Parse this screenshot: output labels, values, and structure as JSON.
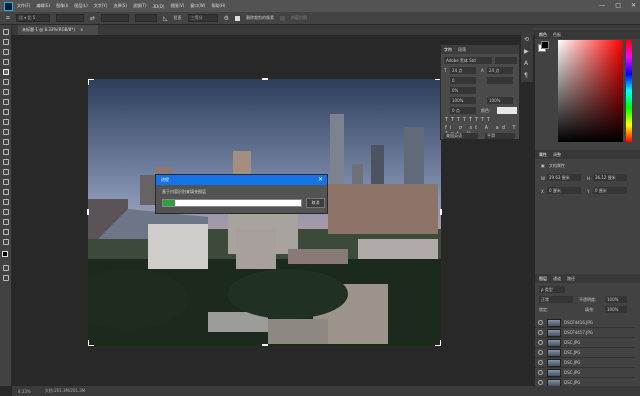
{
  "menubar": {
    "items": [
      "文件(F)",
      "编辑(E)",
      "图像(I)",
      "图层(L)",
      "文字(Y)",
      "选择(S)",
      "滤镜(T)",
      "3D(D)",
      "视图(V)",
      "窗口(W)",
      "帮助(H)"
    ],
    "window_controls": [
      "—",
      "□",
      "✕"
    ]
  },
  "options": {
    "ratio": "比 ▾ 比 5",
    "straighten_label": "拉直",
    "view_label": "三等分",
    "delete_pixels_label": "删除裁剪的像素",
    "content_aware_label": "内容识别"
  },
  "document": {
    "tab_label": "未标题-1 @ 8.33%(RGB/8*)",
    "tab_close": "×"
  },
  "dialog": {
    "title": "进程",
    "close": "✕",
    "message": "基于内容识别来填充图层",
    "progress_percent": 9,
    "cancel_label": "取消"
  },
  "character_panel": {
    "tabs": [
      "字符",
      "段落"
    ],
    "font_family": "Adobe 黑体 Std",
    "size": "24 点",
    "leading": "24 点",
    "tracking": "0",
    "kerning": "0%",
    "scale_v": "100%",
    "scale_h": "100%",
    "baseline": "0 点",
    "color_label": "颜色:",
    "lang": "美国英语",
    "aa": "平滑"
  },
  "color_panel": {
    "tabs": [
      "颜色",
      "色板"
    ]
  },
  "properties_panel": {
    "tabs": [
      "属性",
      "调整"
    ],
    "doc_label": "文档属性",
    "w_label": "W",
    "w_value": "29.63 厘米",
    "h_label": "H",
    "h_value": "36.12 厘米",
    "x_label": "X",
    "x_value": "0 厘米",
    "y_label": "Y",
    "y_value": "0 厘米"
  },
  "layers_panel": {
    "tabs": [
      "图层",
      "通道",
      "路径"
    ],
    "filter_label": "ρ 类型",
    "blend_mode": "正常",
    "opacity_label": "不透明度:",
    "opacity": "100%",
    "lock_label": "锁定:",
    "fill_label": "填充:",
    "fill": "100%",
    "layers": [
      "DSCF4416.JPG",
      "DSCF4417.JPG",
      "DSC.JPG",
      "DSC.JPG",
      "DSC.JPG",
      "DSC.JPG",
      "DSC.JPG",
      "DSC.JPG"
    ]
  },
  "status": {
    "zoom": "8.33%",
    "doc_size": "文档:201.3M/201.3M"
  },
  "colors": {
    "progress_fill": "#2fa040",
    "dialog_title": "#1473e6"
  }
}
